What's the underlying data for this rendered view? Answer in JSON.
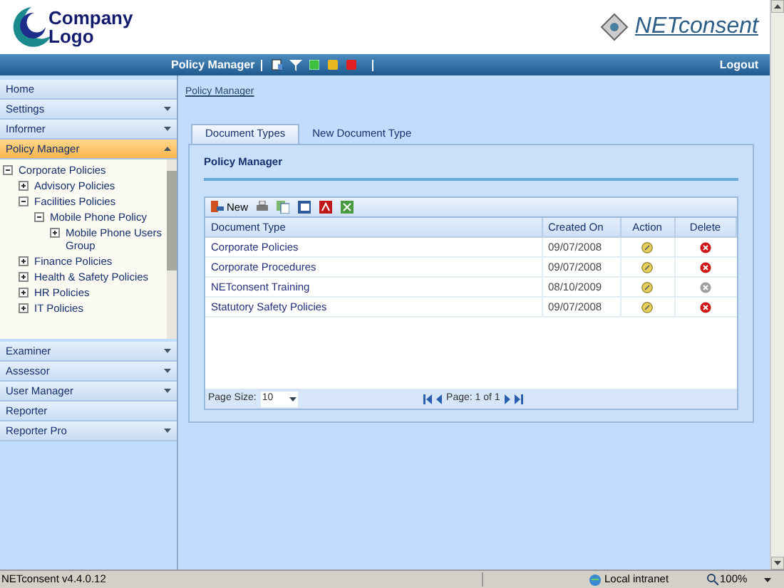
{
  "header": {
    "logo_text": "Company Logo",
    "brand": "NETconsent"
  },
  "navbar": {
    "title": "Policy Manager",
    "logout": "Logout"
  },
  "sidebar": {
    "items_top": [
      {
        "label": "Home",
        "selected": false
      },
      {
        "label": "Settings",
        "selected": false,
        "expanded": false
      },
      {
        "label": "Informer",
        "selected": false,
        "expanded": false
      },
      {
        "label": "Policy Manager",
        "selected": true,
        "expanded": true
      }
    ],
    "tree": [
      {
        "label": "Corporate Policies",
        "expanded": true,
        "children": [
          {
            "label": "Advisory Policies",
            "expanded": false
          },
          {
            "label": "Facilities Policies",
            "expanded": true,
            "children": [
              {
                "label": "Mobile Phone Policy",
                "expanded": true,
                "children": [
                  {
                    "label": "Mobile Phone Users Group",
                    "expanded": false
                  }
                ]
              }
            ]
          },
          {
            "label": "Finance Policies",
            "expanded": false
          },
          {
            "label": "Health & Safety Policies",
            "expanded": false
          },
          {
            "label": "HR Policies",
            "expanded": false
          },
          {
            "label": "IT Policies",
            "expanded": false
          }
        ]
      }
    ],
    "items_bottom": [
      {
        "label": "Examiner",
        "selected": false,
        "expanded": false
      },
      {
        "label": "Assessor",
        "selected": false,
        "expanded": false
      },
      {
        "label": "User Manager",
        "selected": false,
        "expanded": false
      },
      {
        "label": "Reporter",
        "selected": false
      },
      {
        "label": "Reporter Pro",
        "selected": false,
        "expanded": false
      }
    ]
  },
  "breadcrumb": "Policy Manager",
  "tabs": [
    {
      "label": "Document Types",
      "selected": true
    },
    {
      "label": "New Document Type",
      "selected": false
    }
  ],
  "panel_title": "Policy Manager",
  "toolbar": {
    "new_label": "New"
  },
  "table": {
    "columns": [
      "Document Type",
      "Created On",
      "Action",
      "Delete"
    ],
    "rows": [
      {
        "name": "Corporate Policies",
        "created": "09/07/2008",
        "delete_enabled": true
      },
      {
        "name": "Corporate Procedures",
        "created": "09/07/2008",
        "delete_enabled": true
      },
      {
        "name": "NETconsent Training",
        "created": "08/10/2009",
        "delete_enabled": false
      },
      {
        "name": "Statutory Safety Policies",
        "created": "09/07/2008",
        "delete_enabled": true
      }
    ]
  },
  "pager": {
    "page_size_label": "Page Size:",
    "page_size": "10",
    "page_info": "Page: 1 of 1"
  },
  "status_bar": {
    "version": "NETconsent v4.4.0.12",
    "zone": "Local intranet",
    "zoom": "100%"
  }
}
